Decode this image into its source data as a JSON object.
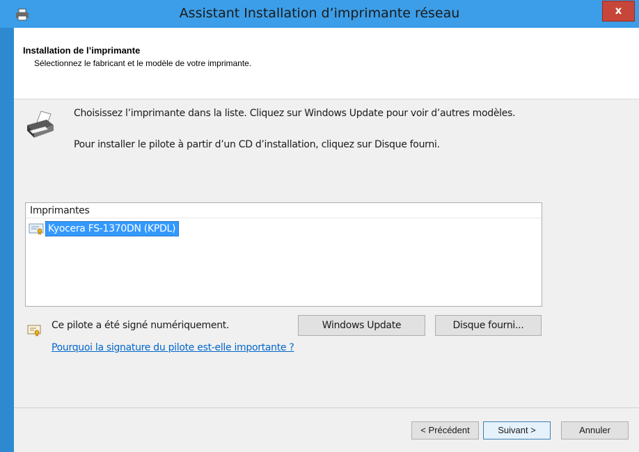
{
  "window": {
    "title": "Assistant Installation d’imprimante réseau",
    "close_label": "x"
  },
  "header": {
    "title": "Installation de l’imprimante",
    "subtitle": "Sélectionnez le fabricant et le modèle de votre imprimante."
  },
  "body": {
    "instruction1": "Choisissez l’imprimante dans la liste. Cliquez sur Windows Update pour voir d’autres modèles.",
    "instruction2": "Pour installer le pilote à partir d’un CD d’installation, cliquez sur Disque fourni."
  },
  "printer_list": {
    "column_header": "Imprimantes",
    "items": [
      {
        "label": "Kyocera FS-1370DN (KPDL)",
        "selected": true,
        "icon": "certificate-icon"
      }
    ]
  },
  "signature": {
    "status_text": "Ce pilote a été signé numériquement.",
    "link_text": "Pourquoi la signature du pilote est-elle importante ?"
  },
  "buttons": {
    "windows_update": "Windows Update",
    "have_disk": "Disque fourni...",
    "back": "< Précédent",
    "next": "Suivant >",
    "cancel": "Annuler"
  },
  "colors": {
    "title_bar": "#3c9ee8",
    "close_button": "#c7463a",
    "selection": "#3399ff",
    "link": "#0066cc"
  }
}
